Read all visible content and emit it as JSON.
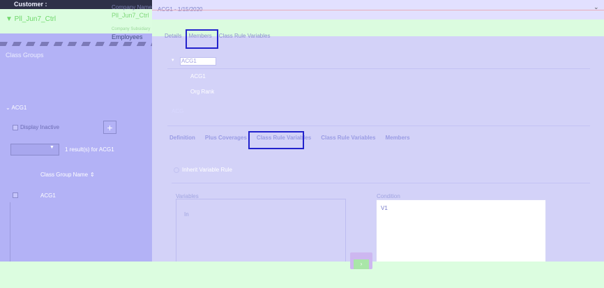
{
  "sidebar": {
    "customer_label": "Customer :",
    "customer_value": "▼ Pll_Jun7_Ctrl",
    "company_name_label": "Company Name",
    "company_name_value": "Pll_Jun7_Ctrl",
    "company_sub_label": "Company Subsidiary",
    "company_sub_value": "Employees",
    "class_groups_title": "Class Groups",
    "tree_item": "ACG1",
    "display_inactive_label": "Display Inactive",
    "add_button": "+",
    "results_count": "1 result(s) for ACG1",
    "column_header": "Class Group Name",
    "sort_icon": "⇕",
    "rows": [
      {
        "name": "ACG1"
      }
    ]
  },
  "main": {
    "breadcrumb": "ACG1 - 1/15/2020",
    "chevron": "⌄",
    "tabs_top": [
      "Details",
      "Members",
      "Class Rule Variables"
    ],
    "tree": {
      "caret": "▾",
      "root": "ACG1",
      "children": [
        "ACG1",
        "Org Rank"
      ],
      "next_item": "ACG"
    },
    "tabs_bottom": [
      "Definition",
      "Plus Coverages",
      "Class Rule Variables",
      "Class Rule Variables",
      "Members"
    ],
    "radio_label": "Inherit Variable Rule",
    "variables_label": "Variables",
    "variables_value": "In",
    "condition_label": "Condition",
    "condition_value": "V1",
    "action_button": "›"
  },
  "colors": {
    "sidebar_bg": "#b3b2f6",
    "main_bg": "#d3d2f8",
    "focus_ring": "#2222cc",
    "overlay_green": "#dcfde0"
  }
}
